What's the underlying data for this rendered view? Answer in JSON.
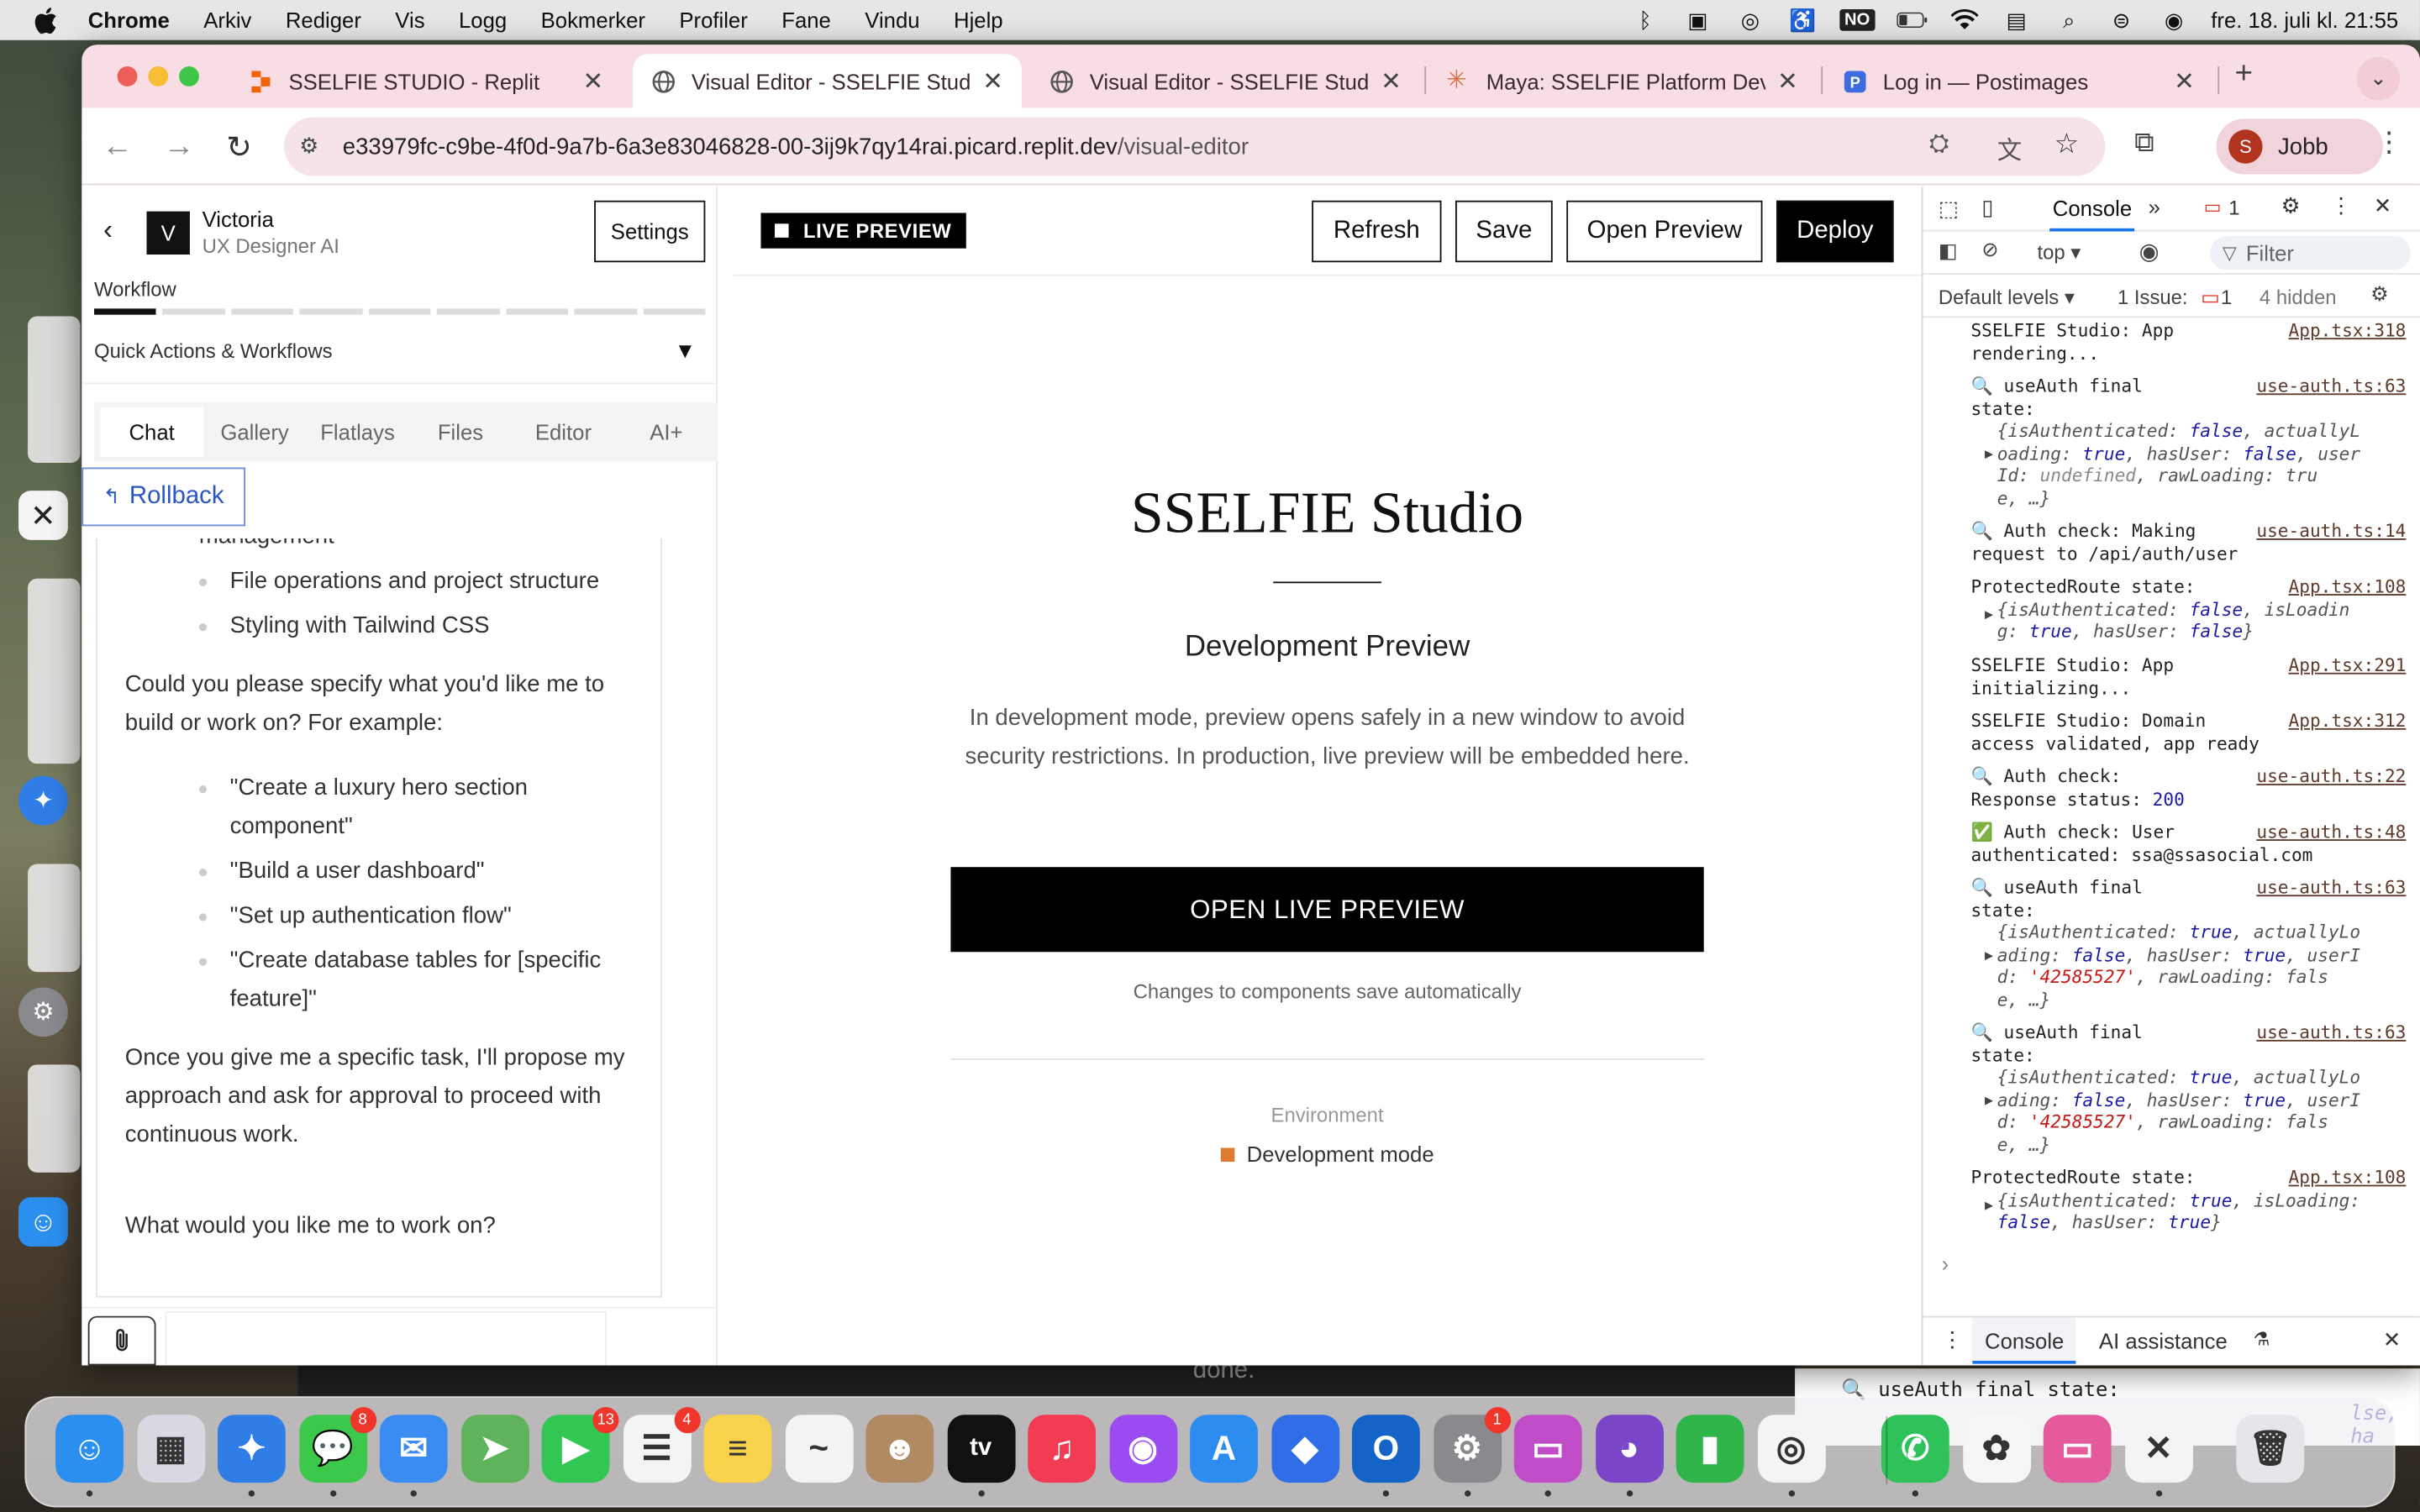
{
  "menubar": {
    "app_name": "Chrome",
    "items": [
      "Arkiv",
      "Rediger",
      "Vis",
      "Logg",
      "Bokmerker",
      "Profiler",
      "Fane",
      "Vindu",
      "Hjelp"
    ],
    "input_source": "NO",
    "datetime": "fre. 18. juli kl. 21:55"
  },
  "browser": {
    "tabs": [
      {
        "title": "SSELFIE STUDIO - Replit",
        "icon": "replit-icon",
        "active": false
      },
      {
        "title": "Visual Editor - SSELFIE Studio",
        "icon": "globe-icon",
        "active": true
      },
      {
        "title": "Visual Editor - SSELFIE Studio",
        "icon": "globe-icon",
        "active": false
      },
      {
        "title": "Maya: SSELFIE Platform Dev A",
        "icon": "claude-icon",
        "active": false
      },
      {
        "title": "Log in — Postimages",
        "icon": "postimages-icon",
        "active": false
      }
    ],
    "url_host": "e33979fc-c9be-4f0d-9a7b-6a3e83046828-00-3ij9k7qy14rai.picard.replit.dev",
    "url_path": "/visual-editor",
    "profile_initial": "S",
    "profile_label": "Jobb"
  },
  "left_panel": {
    "agent_initial": "V",
    "agent_name": "Victoria",
    "agent_role": "UX Designer AI",
    "settings_label": "Settings",
    "workflow_label": "Workflow",
    "workflow_steps_total": 9,
    "workflow_steps_done": 1,
    "quick_actions_label": "Quick Actions & Workflows",
    "tabs": [
      "Chat",
      "Gallery",
      "Flatlays",
      "Files",
      "Editor",
      "AI+"
    ],
    "selected_tab": "Chat",
    "rollback_label": "Rollback",
    "chat": {
      "cut_line": "management",
      "bullets1": [
        "File operations and project structure",
        "Styling with Tailwind CSS"
      ],
      "para1": "Could you please specify what you'd like me to build or work on? For example:",
      "examples": [
        "\"Create a luxury hero section component\"",
        "\"Build a user dashboard\"",
        "\"Set up authentication flow\"",
        "\"Create database tables for [specific feature]\""
      ],
      "para2": "Once you give me a specific task, I'll propose my approach and ask for approval to proceed with continuous work.",
      "para3": "What would you like me to work on?"
    }
  },
  "editor": {
    "live_label": "LIVE PREVIEW",
    "buttons": {
      "refresh": "Refresh",
      "save": "Save",
      "open_preview": "Open Preview",
      "deploy": "Deploy"
    },
    "preview": {
      "title": "SSELFIE Studio",
      "subtitle": "Development Preview",
      "description": "In development mode, preview opens safely in a new window to avoid security restrictions. In production, live preview will be embedded here.",
      "open_button": "OPEN LIVE PREVIEW",
      "auto_note": "Changes to components save automatically",
      "env_label": "Environment",
      "env_value": "Development mode"
    }
  },
  "devtools": {
    "console_tab": "Console",
    "message_count": "1",
    "context": "top",
    "filter_placeholder": "Filter",
    "levels": "Default levels",
    "issues_label": "1 Issue:",
    "issues_count": "1",
    "hidden": "4 hidden",
    "bottom_tabs": [
      "Console",
      "AI assistance"
    ]
  },
  "console_entries": [
    {
      "msg": "SSELFIE Studio: App\nrendering...",
      "src": "App.tsx:318"
    },
    {
      "msg": "🔍 useAuth final\nstate:",
      "src": "use-auth.ts:63",
      "obj": [
        "{isAuthenticated: false, actuallyL",
        "oading: true, hasUser: false, user",
        "Id: undefined, rawLoading: tru",
        "e, …}"
      ]
    },
    {
      "msg": "🔍 Auth check: Making\nrequest to /api/auth/user",
      "src": "use-auth.ts:14"
    },
    {
      "msg": "ProtectedRoute state:",
      "src": "App.tsx:108",
      "obj": [
        "{isAuthenticated: false, isLoadin",
        "g: true, hasUser: false}"
      ]
    },
    {
      "msg": "SSELFIE Studio: App\ninitializing...",
      "src": "App.tsx:291"
    },
    {
      "msg": "SSELFIE Studio: Domain\naccess validated, app ready",
      "src": "App.tsx:312"
    },
    {
      "msg": "🔍 Auth check:\nResponse status: 200",
      "src": "use-auth.ts:22"
    },
    {
      "msg": "✅ Auth check: User\nauthenticated: ssa@ssasocial.com",
      "src": "use-auth.ts:48"
    },
    {
      "msg": "🔍 useAuth final\nstate:",
      "src": "use-auth.ts:63",
      "obj": [
        "{isAuthenticated: true, actuallyLo",
        "ading: false, hasUser: true, userI",
        "d: '42585527', rawLoading: fals",
        "e, …}"
      ]
    },
    {
      "msg": "🔍 useAuth final\nstate:",
      "src": "use-auth.ts:63",
      "obj": [
        "{isAuthenticated: true, actuallyLo",
        "ading: false, hasUser: true, userI",
        "d: '42585527', rawLoading: fals",
        "e, …}"
      ]
    },
    {
      "msg": "ProtectedRoute state:",
      "src": "App.tsx:108",
      "obj": [
        "{isAuthenticated: true, isLoading:",
        "false, hasUser: true}"
      ]
    }
  ],
  "background": {
    "strip_text": "🔍 useAuth final state:",
    "strip_text2": "lse, ha",
    "done_text": "done."
  },
  "dock": {
    "apps": [
      {
        "name": "finder-icon",
        "color": "#2b8ff0",
        "glyph": "☺"
      },
      {
        "name": "launchpad-icon",
        "color": "#d8d8e0",
        "glyph": "▦"
      },
      {
        "name": "safari-icon",
        "color": "#2f7de6",
        "glyph": "✦"
      },
      {
        "name": "messages-icon",
        "color": "#3cc84b",
        "glyph": "💬",
        "badge": "8"
      },
      {
        "name": "mail-icon",
        "color": "#3a8cf2",
        "glyph": "✉"
      },
      {
        "name": "maps-icon",
        "color": "#5fb35a",
        "glyph": "➤"
      },
      {
        "name": "facetime-icon",
        "color": "#31c752",
        "glyph": "▶",
        "badge": "13"
      },
      {
        "name": "reminders-icon",
        "color": "#f4f4f4",
        "glyph": "☰",
        "badge": "4"
      },
      {
        "name": "notes-icon",
        "color": "#f8d24a",
        "glyph": "≡"
      },
      {
        "name": "freeform-icon",
        "color": "#f3f3f3",
        "glyph": "~"
      },
      {
        "name": "contacts-icon",
        "color": "#b08a62",
        "glyph": "☻"
      },
      {
        "name": "apple-tv-icon",
        "color": "#111111",
        "glyph": "tv"
      },
      {
        "name": "music-icon",
        "color": "#f23c53",
        "glyph": "♫"
      },
      {
        "name": "podcasts-icon",
        "color": "#9a4cf0",
        "glyph": "◉"
      },
      {
        "name": "app-store-icon",
        "color": "#2d8cf0",
        "glyph": "A"
      },
      {
        "name": "replit-dock-icon",
        "color": "#2f6ee6",
        "glyph": "◆"
      },
      {
        "name": "outlook-icon",
        "color": "#1464c8",
        "glyph": "O"
      },
      {
        "name": "system-settings-icon",
        "color": "#8a8a8e",
        "glyph": "⚙",
        "badge": "1"
      },
      {
        "name": "keynote-icon",
        "color": "#c04cc8",
        "glyph": "▭"
      },
      {
        "name": "github-desktop-icon",
        "color": "#7a45c6",
        "glyph": "◕"
      },
      {
        "name": "numbers-icon",
        "color": "#2fb54a",
        "glyph": "▮"
      },
      {
        "name": "chrome-icon",
        "color": "#f4f4f4",
        "glyph": "◎"
      },
      {
        "name": "whatsapp-icon",
        "color": "#2fc15a",
        "glyph": "✆"
      },
      {
        "name": "photos-icon",
        "color": "#f6f6f6",
        "glyph": "✿"
      },
      {
        "name": "preview-icon",
        "color": "#e45a9c",
        "glyph": "▭"
      },
      {
        "name": "sselfie-app-icon",
        "color": "#f4f4f4",
        "glyph": "✕"
      },
      {
        "name": "trash-icon",
        "color": "#e6e6ea",
        "glyph": "🗑"
      }
    ]
  },
  "colors": {
    "tab_bar": "#f8dde4",
    "accent_blue": "#1a73e8",
    "dev_mode_dot": "#e07a30"
  }
}
